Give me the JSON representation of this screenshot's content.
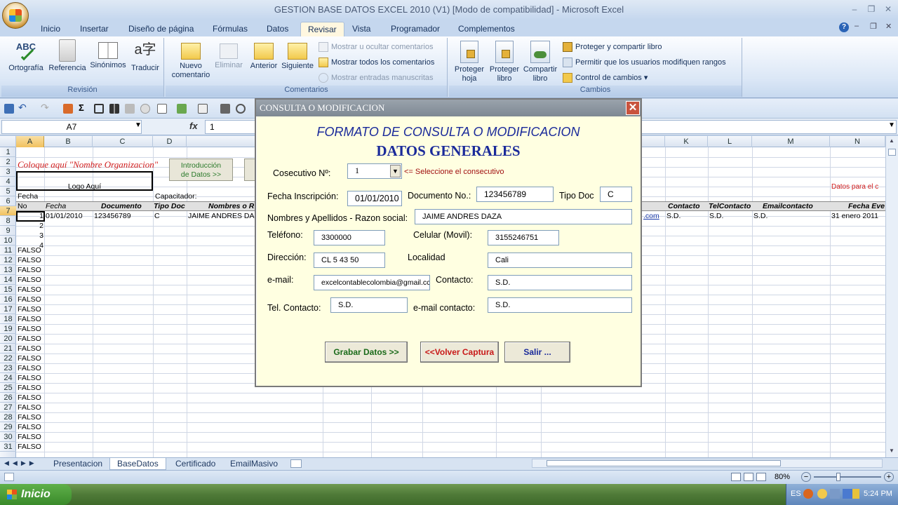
{
  "window": {
    "title": "GESTION BASE DATOS EXCEL 2010 (V1)  [Modo de compatibilidad] - Microsoft Excel"
  },
  "tabs": [
    "Inicio",
    "Insertar",
    "Diseño de página",
    "Fórmulas",
    "Datos",
    "Revisar",
    "Vista",
    "Programador",
    "Complementos"
  ],
  "ribbon": {
    "revision": {
      "label": "Revisión",
      "ortografia": "Ortografía",
      "referencia": "Referencia",
      "sinonimos": "Sinónimos",
      "traducir": "Traducir"
    },
    "comentarios": {
      "label": "Comentarios",
      "nuevo1": "Nuevo",
      "nuevo2": "comentario",
      "eliminar": "Eliminar",
      "anterior": "Anterior",
      "siguiente": "Siguiente",
      "mostrar_ocultar": "Mostrar u ocultar comentarios",
      "mostrar_todos": "Mostrar todos los comentarios",
      "mostrar_entradas": "Mostrar entradas manuscritas"
    },
    "cambios": {
      "label": "Cambios",
      "proteger_hoja1": "Proteger",
      "proteger_hoja2": "hoja",
      "proteger_libro1": "Proteger",
      "proteger_libro2": "libro",
      "compartir1": "Compartir",
      "compartir2": "libro",
      "proteger_compartir": "Proteger y compartir libro",
      "permitir": "Permitir que los usuarios modifiquen rangos",
      "control": "Control de cambios"
    }
  },
  "formula": {
    "namebox": "A7",
    "fx": "fx",
    "value": "1"
  },
  "columns": [
    "A",
    "B",
    "C",
    "D",
    "K",
    "L",
    "M",
    "N"
  ],
  "sheet": {
    "a2": "Coloque aquí \"Nombre Organizacion\"",
    "intro1": "Introducción",
    "intro2": "de Datos >>",
    "logo": "Logo Aquí",
    "a5": "Fecha",
    "capacitador": "Capacitador:",
    "datos_para": "Datos para el c",
    "headers": {
      "no": "No",
      "fecha": "Fecha",
      "documento": "Documento",
      "tipodoc": "Tipo Doc",
      "nombres": "Nombres o R",
      "contacto": "Contacto",
      "telcontacto": "TelContacto",
      "emailcontacto": "Emailcontacto",
      "fechaev": "Fecha Eve"
    },
    "row7": {
      "no": "1",
      "fecha": "01/01/2010",
      "documento": "123456789",
      "tipo": "C",
      "nombre": "JAIME ANDRES DA",
      "email_tail": ".com",
      "contacto": "S.D.",
      "tel": "S.D.",
      "emailc": "S.D.",
      "fechaev": "31 enero 2011"
    },
    "row_nums": [
      "2",
      "3",
      "4"
    ],
    "falso": "FALSO"
  },
  "sheet_tabs": [
    "Presentacion",
    "BaseDatos",
    "Certificado",
    "EmailMasivo"
  ],
  "status": {
    "zoom": "80%"
  },
  "taskbar": {
    "start": "Inicio",
    "lang": "ES",
    "time": "5:24 PM"
  },
  "dialog": {
    "title": "CONSULTA O MODIFICACION",
    "heading1": "FORMATO DE CONSULTA O MODIFICACION",
    "heading2": "DATOS GENERALES",
    "consecutivo_label": "Cosecutivo Nº:",
    "consecutivo_value": "1",
    "consecutivo_hint": "<= Seleccione el consecutivo",
    "fecha_label": "Fecha Inscripción:",
    "fecha_value": "01/01/2010",
    "documento_label": "Documento No.:",
    "documento_value": "123456789",
    "tipodoc_label": "Tipo Doc",
    "tipodoc_value": "C",
    "nombres_label": "Nombres y Apellidos - Razon social:",
    "nombres_value": "JAIME ANDRES DAZA",
    "telefono_label": "Teléfono:",
    "telefono_value": "3300000",
    "celular_label": "Celular (Movil):",
    "celular_value": "3155246751",
    "direccion_label": "Dirección:",
    "direccion_value": "CL 5 43 50",
    "localidad_label": "Localidad",
    "localidad_value": "Cali",
    "email_label": "e-mail:",
    "email_value": "excelcontablecolombia@gmail.cc",
    "contacto_label": "Contacto:",
    "contacto_value": "S.D.",
    "telcontacto_label": "Tel. Contacto:",
    "telcontacto_value": "S.D.",
    "emailcontacto_label": "e-mail contacto:",
    "emailcontacto_value": "S.D.",
    "btn_grabar": "Grabar Datos >>",
    "btn_volver": "<<Volver Captura",
    "btn_salir": "Salir ...",
    "colors": {
      "heading": "#1a2a9a",
      "grabar": "#1a6a1a",
      "volver": "#c81818",
      "salir": "#1a2a9a",
      "hint": "#a01010"
    }
  }
}
